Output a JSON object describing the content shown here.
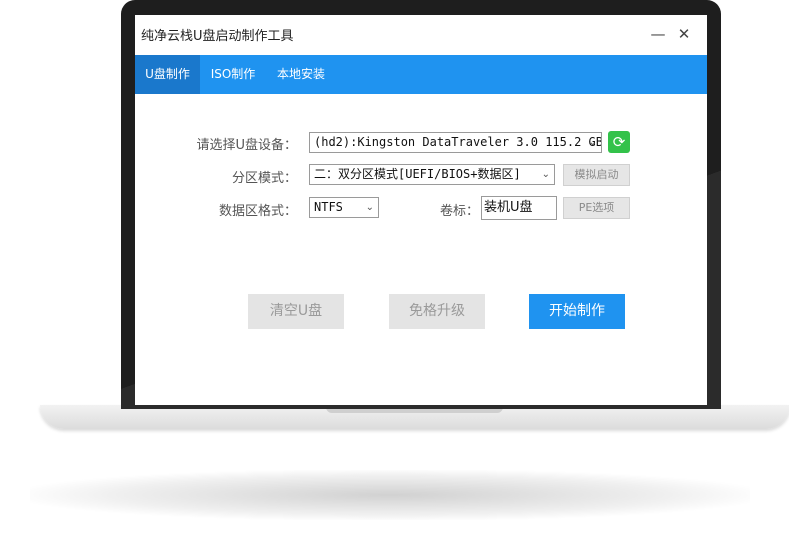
{
  "window": {
    "title": "纯净云栈U盘启动制作工具",
    "minimize_glyph": "—",
    "close_glyph": "✕"
  },
  "tabs": [
    {
      "label": "U盘制作",
      "active": true
    },
    {
      "label": "ISO制作",
      "active": false
    },
    {
      "label": "本地安装",
      "active": false
    }
  ],
  "form": {
    "device_label": "请选择U盘设备：",
    "device_value": "(hd2):Kingston DataTraveler 3.0 115.2 GB",
    "partition_label": "分区模式：",
    "partition_value": "二：双分区模式[UEFI/BIOS+数据区]",
    "simulate_button": "模拟启动",
    "format_label": "数据区格式：",
    "format_value": "NTFS",
    "volume_label": "卷标：",
    "volume_value": "装机U盘",
    "pe_button": "PE选项",
    "refresh_icon": "refresh-icon"
  },
  "actions": {
    "clear": "清空U盘",
    "upgrade": "免格升级",
    "start": "开始制作"
  },
  "colors": {
    "accent": "#1f93f0",
    "accent_active_tab": "#1a78cc",
    "refresh_green": "#33c24a",
    "disabled_gray": "#e4e4e4"
  }
}
